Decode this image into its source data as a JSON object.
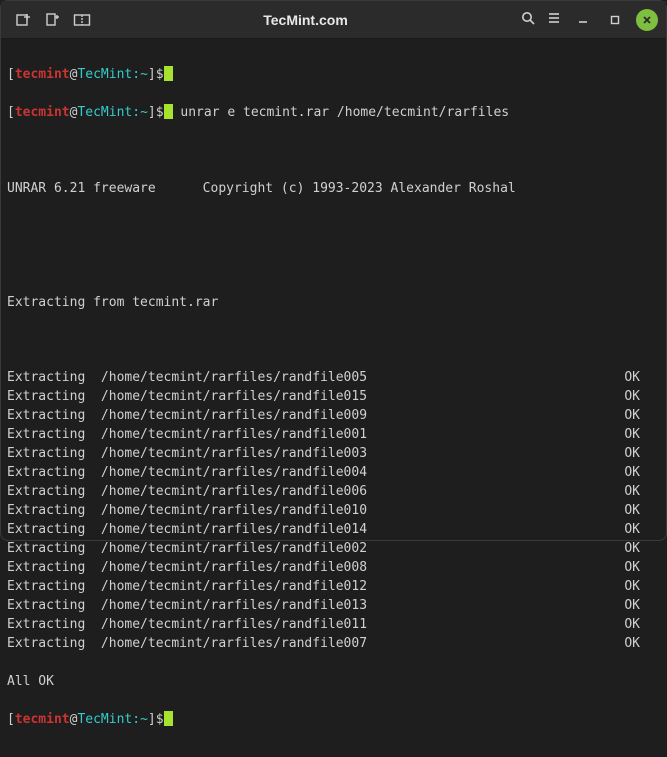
{
  "window": {
    "title": "TecMint.com"
  },
  "prompt": {
    "user": "tecmint",
    "host": "TecMint",
    "path": "~",
    "command": "unrar e tecmint.rar /home/tecmint/rarfiles"
  },
  "output": {
    "version_line": "UNRAR 6.21 freeware      Copyright (c) 1993-2023 Alexander Roshal",
    "extracting_from": "Extracting from tecmint.rar",
    "extract_label": "Extracting",
    "ok_label": "OK",
    "all_ok": "All OK",
    "files": [
      "/home/tecmint/rarfiles/randfile005",
      "/home/tecmint/rarfiles/randfile015",
      "/home/tecmint/rarfiles/randfile009",
      "/home/tecmint/rarfiles/randfile001",
      "/home/tecmint/rarfiles/randfile003",
      "/home/tecmint/rarfiles/randfile004",
      "/home/tecmint/rarfiles/randfile006",
      "/home/tecmint/rarfiles/randfile010",
      "/home/tecmint/rarfiles/randfile014",
      "/home/tecmint/rarfiles/randfile002",
      "/home/tecmint/rarfiles/randfile008",
      "/home/tecmint/rarfiles/randfile012",
      "/home/tecmint/rarfiles/randfile013",
      "/home/tecmint/rarfiles/randfile011",
      "/home/tecmint/rarfiles/randfile007"
    ]
  }
}
